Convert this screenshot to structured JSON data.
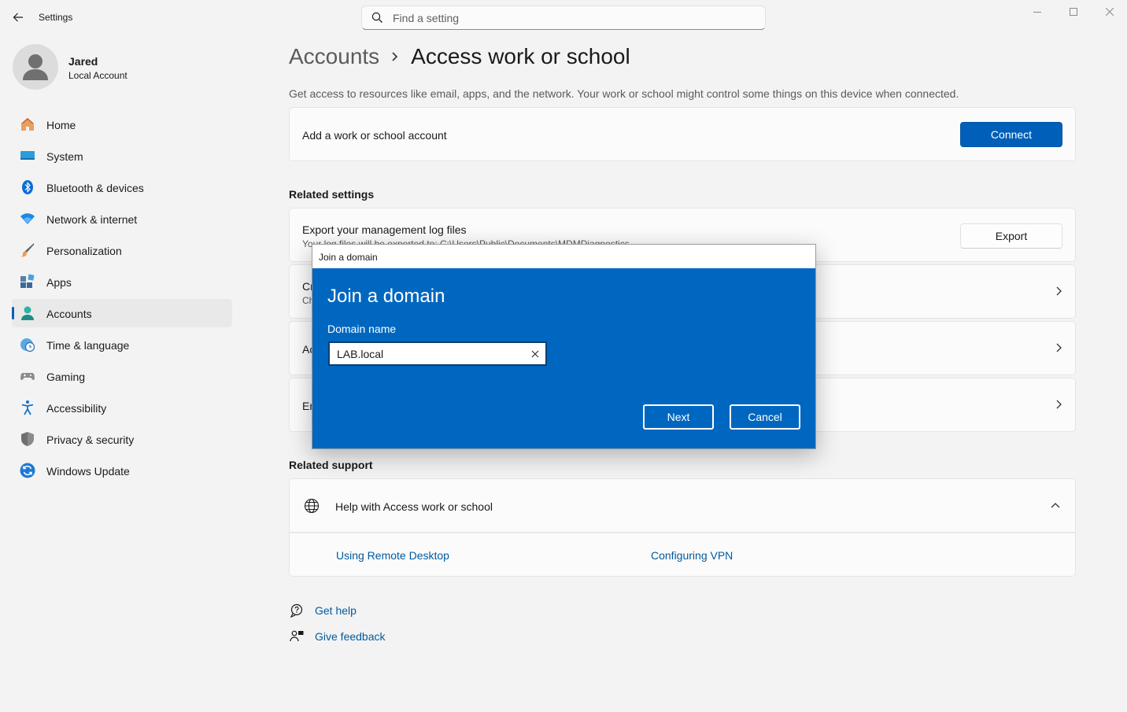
{
  "window": {
    "title": "Settings",
    "controls": [
      "minimize-icon",
      "maximize-icon",
      "close-icon"
    ]
  },
  "search": {
    "placeholder": "Find a setting",
    "value": ""
  },
  "profile": {
    "name": "Jared",
    "account_type": "Local Account"
  },
  "sidebar": {
    "items": [
      {
        "label": "Home",
        "icon": "home-icon"
      },
      {
        "label": "System",
        "icon": "system-icon"
      },
      {
        "label": "Bluetooth & devices",
        "icon": "bluetooth-icon"
      },
      {
        "label": "Network & internet",
        "icon": "wifi-icon"
      },
      {
        "label": "Personalization",
        "icon": "brush-icon"
      },
      {
        "label": "Apps",
        "icon": "apps-icon"
      },
      {
        "label": "Accounts",
        "icon": "accounts-icon",
        "selected": true
      },
      {
        "label": "Time & language",
        "icon": "clock-globe-icon"
      },
      {
        "label": "Gaming",
        "icon": "gamepad-icon"
      },
      {
        "label": "Accessibility",
        "icon": "accessibility-icon"
      },
      {
        "label": "Privacy & security",
        "icon": "shield-icon"
      },
      {
        "label": "Windows Update",
        "icon": "update-icon"
      }
    ]
  },
  "main": {
    "breadcrumb_parent": "Accounts",
    "breadcrumb_current": "Access work or school",
    "description": "Get access to resources like email, apps, and the network. Your work or school might control some things on this device when connected.",
    "add_account": {
      "label": "Add a work or school account",
      "button": "Connect"
    },
    "related_settings_title": "Related settings",
    "export": {
      "label": "Export your management log files",
      "sublabel": "Your log files will be exported to: C:\\Users\\Public\\Documents\\MDMDiagnostics",
      "button": "Export"
    },
    "partial_rows": [
      {
        "label": "Cr",
        "sublabel": "Ch"
      },
      {
        "label": "Ac",
        "sublabel": ""
      },
      {
        "label": "En",
        "sublabel": ""
      }
    ],
    "related_support_title": "Related support",
    "help": {
      "label": "Help with Access work or school",
      "links": [
        "Using Remote Desktop",
        "Configuring VPN"
      ]
    },
    "footer": {
      "get_help": "Get help",
      "give_feedback": "Give feedback"
    }
  },
  "dialog": {
    "window_title": "Join a domain",
    "heading": "Join a domain",
    "field_label": "Domain name",
    "field_value": "LAB.local",
    "next_label": "Next",
    "cancel_label": "Cancel",
    "background_color": "#0067c0"
  },
  "colors": {
    "accent": "#005fb8",
    "link": "#005a9e",
    "dialog_blue": "#0067c0"
  }
}
